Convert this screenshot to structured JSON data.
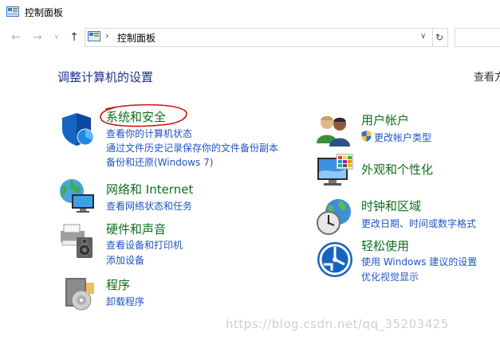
{
  "window": {
    "title": "控制面板"
  },
  "nav": {
    "back": "←",
    "forward": "→",
    "recent": "∨",
    "up": "↑",
    "address_sep": "›",
    "address_text": "控制面板",
    "address_dropdown": "∨",
    "refresh": "↻"
  },
  "main": {
    "heading": "调整计算机的设置",
    "view_by": "查看方",
    "left": [
      {
        "title": "系统和安全",
        "links": [
          "查看你的计算机状态",
          "通过文件历史记录保存你的文件备份副本",
          "备份和还原(Windows 7)"
        ]
      },
      {
        "title": "网络和 Internet",
        "links": [
          "查看网络状态和任务"
        ]
      },
      {
        "title": "硬件和声音",
        "links": [
          "查看设备和打印机",
          "添加设备"
        ]
      },
      {
        "title": "程序",
        "links": [
          "卸载程序"
        ]
      }
    ],
    "right": [
      {
        "title": "用户帐户",
        "links": [
          "更改帐户类型"
        ]
      },
      {
        "title": "外观和个性化",
        "links": []
      },
      {
        "title": "时钟和区域",
        "links": [
          "更改日期、时间或数字格式"
        ]
      },
      {
        "title": "轻松使用",
        "links": [
          "使用 Windows 建议的设置",
          "优化视觉显示"
        ]
      }
    ]
  },
  "watermark": "https://blog.csdn.net/qq_35203425",
  "colors": {
    "category_title": "#0f6e1e",
    "link": "#1f55c2",
    "heading": "#1e3287",
    "annotation": "#d01010"
  }
}
